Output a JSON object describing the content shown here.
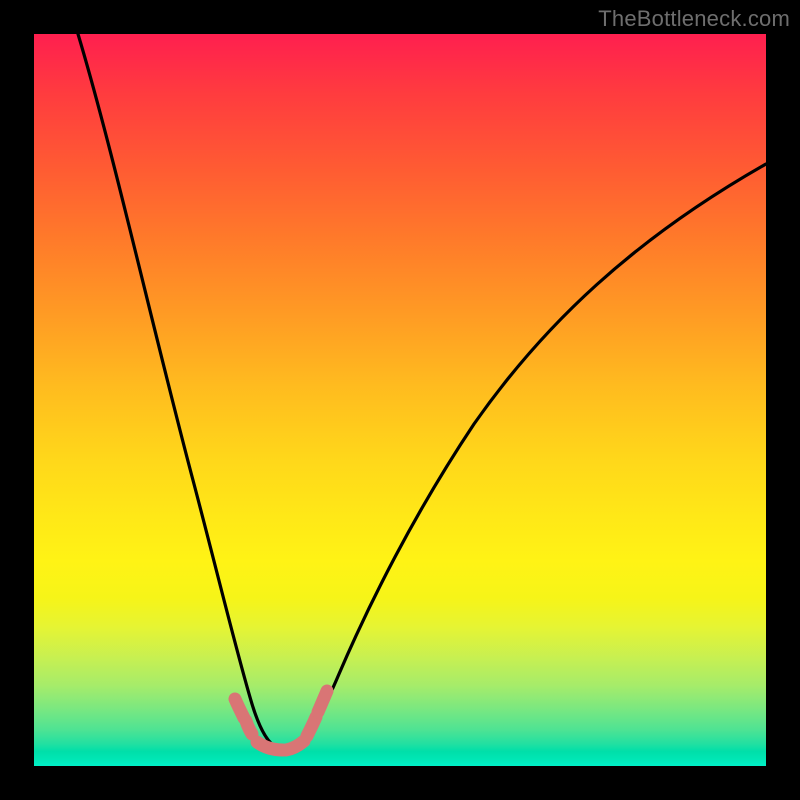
{
  "watermark": "TheBottleneck.com",
  "chart_data": {
    "type": "area",
    "title": "",
    "xlabel": "",
    "ylabel": "",
    "xlim": [
      0,
      100
    ],
    "ylim": [
      0,
      100
    ],
    "grid": false,
    "legend": false,
    "background_gradient": {
      "orientation": "vertical",
      "stops": [
        {
          "pct": 0,
          "color": "#ff1f4f"
        },
        {
          "pct": 50,
          "color": "#ffd71a"
        },
        {
          "pct": 80,
          "color": "#e6f433"
        },
        {
          "pct": 100,
          "color": "#00f0c8"
        }
      ]
    },
    "series": [
      {
        "name": "bottleneck-curve",
        "color": "#000000",
        "x": [
          5,
          8,
          11,
          14,
          17,
          20,
          23,
          25,
          27,
          29,
          30.5,
          32,
          33,
          35,
          37,
          40,
          44,
          50,
          58,
          68,
          80,
          92,
          100
        ],
        "values": [
          100,
          90,
          80,
          70,
          60,
          50,
          40,
          30,
          20,
          12,
          6,
          3,
          2,
          2,
          5,
          12,
          20,
          30,
          40,
          50,
          58,
          64,
          68
        ]
      },
      {
        "name": "overlay-bumps",
        "color": "#e27070",
        "x": [
          27,
          28,
          29,
          30,
          31,
          32,
          33,
          34,
          35,
          36,
          37
        ],
        "values": [
          9,
          8,
          7,
          6,
          5.5,
          5,
          5.2,
          5.8,
          6.5,
          7.5,
          8.5
        ]
      }
    ],
    "annotations": []
  }
}
